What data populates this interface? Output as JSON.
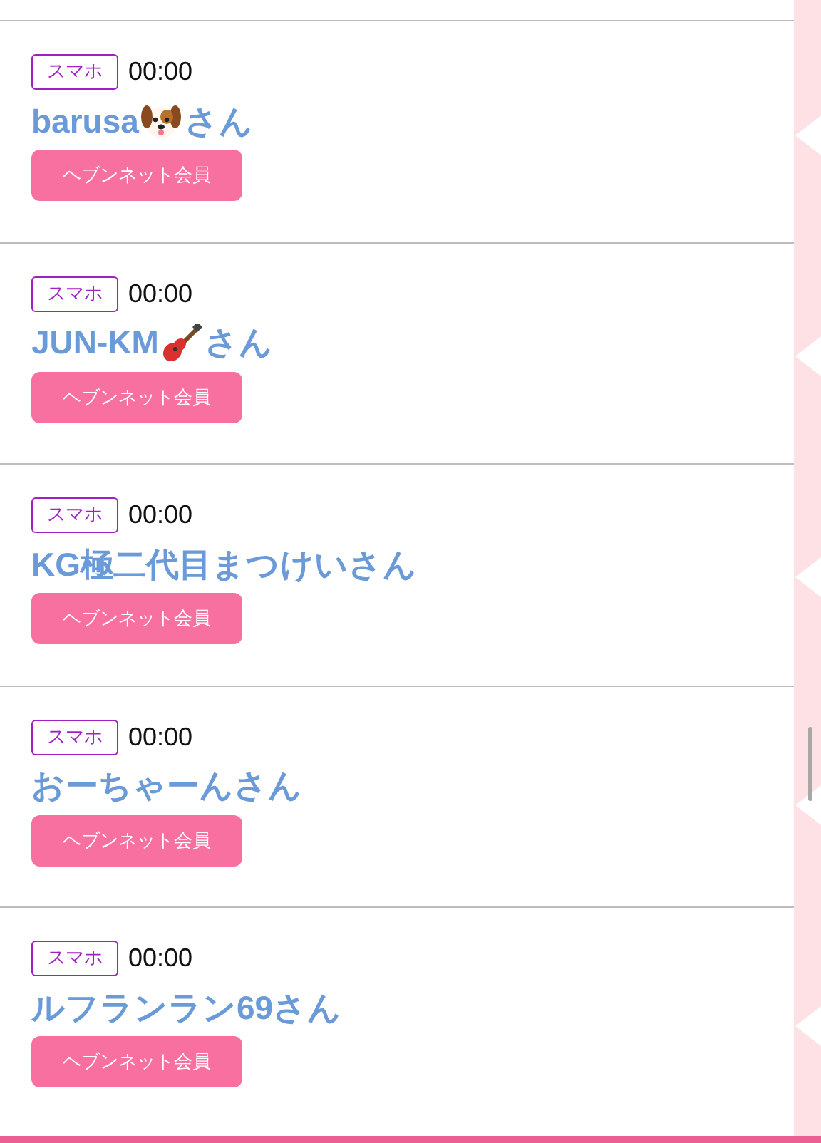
{
  "entries": [
    {
      "device": "スマホ",
      "time": "00:00",
      "name": [
        {
          "kind": "text",
          "text": "barusa"
        },
        {
          "kind": "dog-emoji"
        },
        {
          "kind": "text",
          "text": "さん"
        }
      ],
      "member": "ヘブンネット会員"
    },
    {
      "device": "スマホ",
      "time": "00:00",
      "name": [
        {
          "kind": "text",
          "text": "JUN-KM"
        },
        {
          "kind": "guitar-emoji"
        },
        {
          "kind": "text",
          "text": "さん"
        }
      ],
      "member": "ヘブンネット会員"
    },
    {
      "device": "スマホ",
      "time": "00:00",
      "name": [
        {
          "kind": "text",
          "text": "KG極二代目まつけいさん"
        }
      ],
      "member": "ヘブンネット会員"
    },
    {
      "device": "スマホ",
      "time": "00:00",
      "name": [
        {
          "kind": "text",
          "text": "おーちゃーんさん"
        }
      ],
      "member": "ヘブンネット会員"
    },
    {
      "device": "スマホ",
      "time": "00:00",
      "name": [
        {
          "kind": "text",
          "text": "ルフランラン69さん"
        }
      ],
      "member": "ヘブンネット会員"
    }
  ]
}
